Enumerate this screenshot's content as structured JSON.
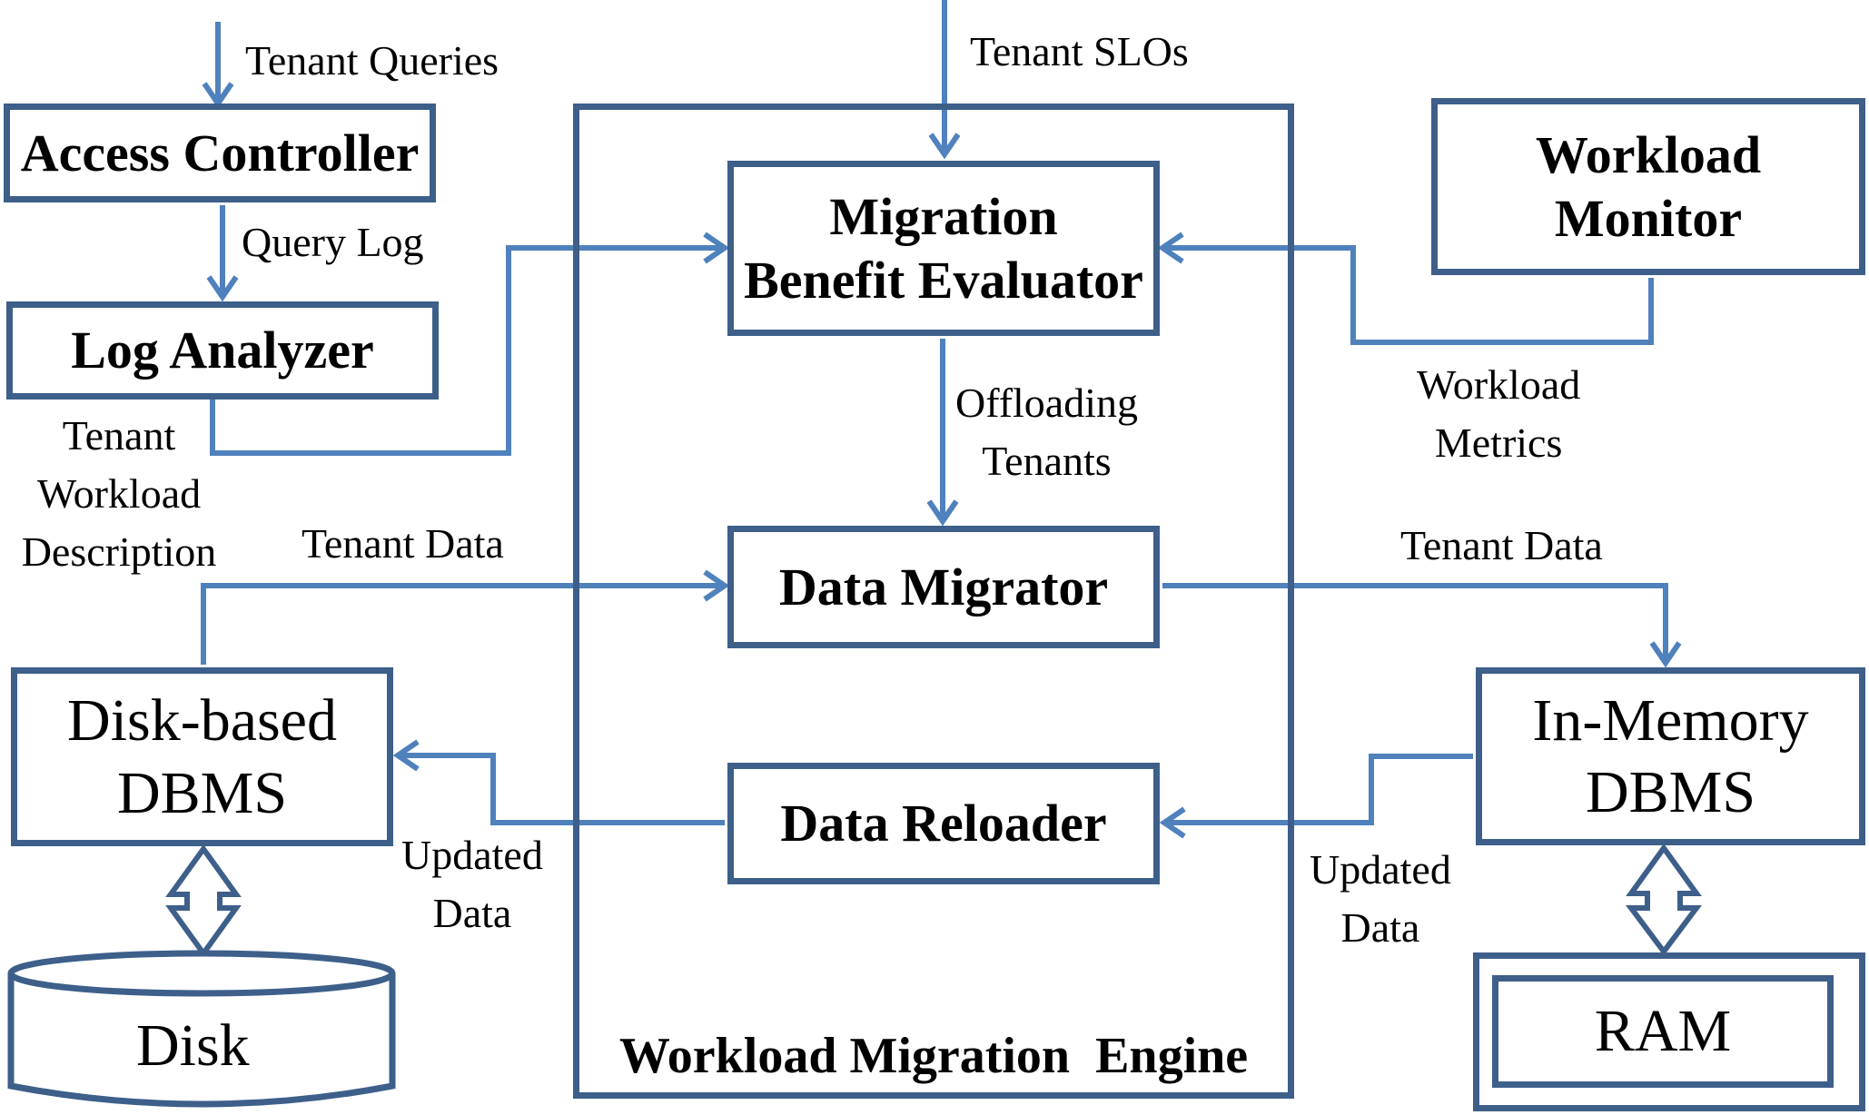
{
  "diagram": {
    "colors": {
      "box_border": "#3d5f8a",
      "arrow": "#4f81bd",
      "text": "#000000"
    },
    "components": {
      "access_controller": "Access Controller",
      "log_analyzer": "Log Analyzer",
      "migration_benefit_evaluator": [
        "Migration",
        "Benefit Evaluator"
      ],
      "data_migrator": "Data Migrator",
      "data_reloader": "Data Reloader",
      "workload_monitor": [
        "Workload",
        "Monitor"
      ],
      "disk_dbms": [
        "Disk-based",
        "DBMS"
      ],
      "disk": "Disk",
      "in_memory_dbms": [
        "In-Memory",
        "DBMS"
      ],
      "ram": "RAM",
      "engine_title": "Workload Migration  Engine"
    },
    "edge_labels": {
      "tenant_queries": "Tenant Queries",
      "query_log": "Query Log",
      "tenant_workload_description": [
        "Tenant",
        "Workload",
        "Description"
      ],
      "tenant_slos": "Tenant SLOs",
      "offloading_tenants": [
        "Offloading",
        "Tenants"
      ],
      "workload_metrics": [
        "Workload",
        "Metrics"
      ],
      "tenant_data_left": "Tenant Data",
      "tenant_data_right": "Tenant Data",
      "updated_data_left": [
        "Updated",
        "Data"
      ],
      "updated_data_right": [
        "Updated",
        "Data"
      ]
    }
  }
}
